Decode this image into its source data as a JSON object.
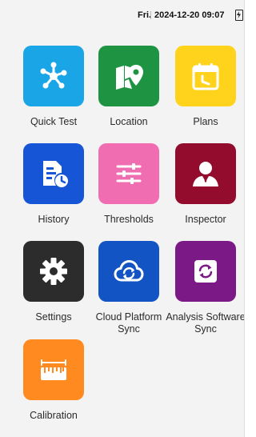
{
  "status_bar": {
    "day": "Fri.",
    "datetime": "2024-12-20 09:07"
  },
  "apps": [
    {
      "label": "Quick Test",
      "color": "#1aa5e6",
      "icon": "network-nodes-icon"
    },
    {
      "label": "Location",
      "color": "#1e9443",
      "icon": "map-pin-icon"
    },
    {
      "label": "Plans",
      "color": "#ffd21c",
      "icon": "calendar-icon"
    },
    {
      "label": "History",
      "color": "#1655d6",
      "icon": "document-clock-icon"
    },
    {
      "label": "Thresholds",
      "color": "#ef6db0",
      "icon": "sliders-icon"
    },
    {
      "label": "Inspector",
      "color": "#930b2d",
      "icon": "person-icon"
    },
    {
      "label": "Settings",
      "color": "#2c2c2c",
      "icon": "gear-icon"
    },
    {
      "label": "Cloud Platform Sync",
      "color": "#1254c4",
      "icon": "cloud-sync-icon"
    },
    {
      "label": "Analysis Software Sync",
      "color": "#7b1a86",
      "icon": "sync-icon"
    },
    {
      "label": "Calibration",
      "color": "#ff8a1f",
      "icon": "ruler-icon"
    }
  ]
}
